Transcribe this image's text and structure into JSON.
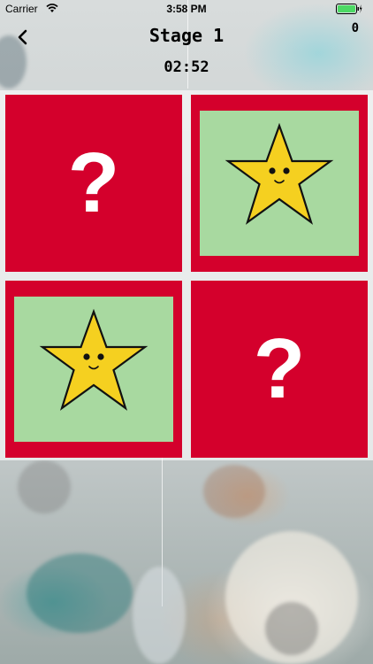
{
  "status_bar": {
    "carrier": "Carrier",
    "time": "3:58 PM",
    "wifi_icon": "wifi-icon",
    "battery_icon": "battery-icon"
  },
  "header": {
    "back_icon": "chevron-left-icon",
    "title": "Stage 1",
    "score": "0",
    "timer": "02:52"
  },
  "board": {
    "cards": [
      {
        "state": "hidden",
        "label": "?"
      },
      {
        "state": "revealed",
        "icon": "star-face-icon"
      },
      {
        "state": "revealed",
        "icon": "star-face-icon"
      },
      {
        "state": "hidden",
        "label": "?"
      }
    ]
  },
  "colors": {
    "card_back": "#d4002c",
    "card_face": "#a8d9a0",
    "star_fill": "#f5d020",
    "question_mark": "#ffffff"
  }
}
